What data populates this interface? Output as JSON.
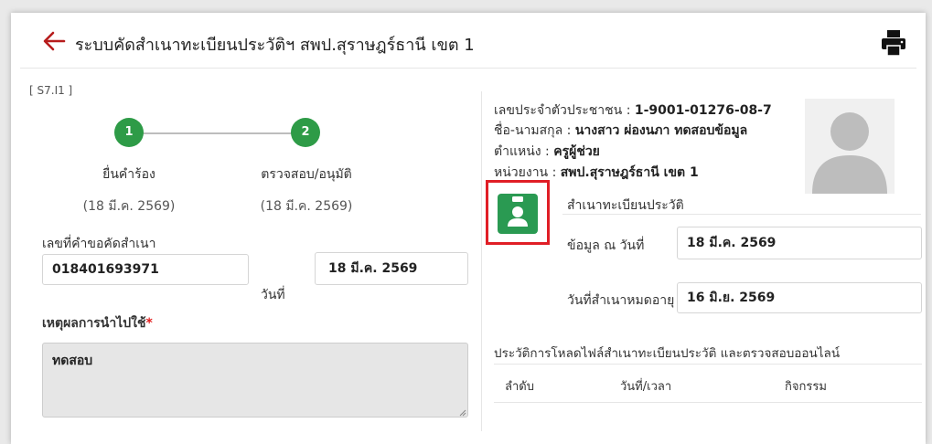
{
  "header": {
    "title": "ระบบคัดสำเนาทะเบียนประวัติฯ สพป.สุราษฎร์ธานี เขต 1"
  },
  "code": "[ S7.I1 ]",
  "steps": [
    {
      "number": "1",
      "label": "ยื่นคำร้อง",
      "date": "(18 มี.ค. 2569)"
    },
    {
      "number": "2",
      "label": "ตรวจสอบ/อนุมัติ",
      "date": "(18 มี.ค. 2569)"
    }
  ],
  "request": {
    "number_label": "เลขที่คำขอคัดสำเนา",
    "number_value": "018401693971",
    "date_label": "วันที่",
    "date_value": "18 มี.ค. 2569",
    "reason_label": "เหตุผลการนำไปใช้",
    "reason_required": "*",
    "reason_value": "ทดสอบ"
  },
  "profile": {
    "id_label": "เลขประจำตัวประชาชน : ",
    "id_value": "1-9001-01276-08-7",
    "name_label": "ชื่อ-นามสกุล : ",
    "name_value": "นางสาว ผ่องนภา ทดสอบข้อมูล",
    "position_label": "ตำแหน่ง : ",
    "position_value": "ครูผู้ช่วย",
    "unit_label": "หน่วยงาน : ",
    "unit_value": "สพป.สุราษฎร์ธานี เขต 1"
  },
  "record": {
    "title": "สำเนาทะเบียนประวัติ",
    "data_date_label": "ข้อมูล ณ วันที่",
    "data_date_value": "18 มี.ค. 2569",
    "expire_label": "วันที่สำเนาหมดอายุ",
    "expire_value": "16 มิ.ย. 2569"
  },
  "history": {
    "title": "ประวัติการโหลดไฟล์สำเนาทะเบียนประวัติ และตรวจสอบออนไลน์",
    "columns": [
      "ลำดับ",
      "วันที่/เวลา",
      "กิจกรรม"
    ]
  },
  "colors": {
    "accent_red": "#b71c1c",
    "step_green": "#2e9b47",
    "highlight_box": "#e01e26"
  },
  "icons": {
    "back": "arrow-left-icon",
    "print": "printer-icon",
    "avatar": "user-placeholder-icon",
    "badge": "id-badge-icon"
  }
}
